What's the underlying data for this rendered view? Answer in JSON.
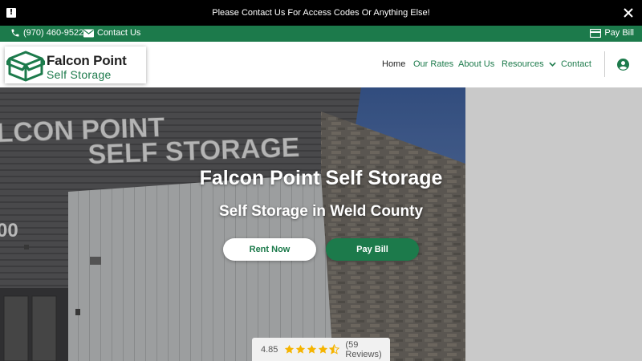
{
  "announcement": {
    "text": "Please Contact Us For Access Codes Or Anything Else!"
  },
  "topbar": {
    "phone": "(970) 460-9522",
    "contact": "Contact Us",
    "pay_bill": "Pay Bill"
  },
  "logo": {
    "line1": "Falcon Point",
    "line2": "Self Storage"
  },
  "nav": {
    "items": [
      {
        "label": "Home"
      },
      {
        "label": "Our Rates"
      },
      {
        "label": "About Us"
      },
      {
        "label": "Resources"
      },
      {
        "label": "Contact"
      }
    ]
  },
  "hero": {
    "title": "Falcon Point Self Storage",
    "subtitle": "Self Storage in Weld County",
    "rent_button": "Rent Now",
    "pay_button": "Pay Bill",
    "sign_line1": "LCON POINT",
    "sign_line2": "SELF STORAGE",
    "address_fragment": "00"
  },
  "reviews": {
    "score": "4.85",
    "count": "(59 Reviews)",
    "rating": 4.85
  },
  "colors": {
    "brand_green": "#1c7a4b",
    "announcement_bg": "#000000",
    "star": "#f5b400"
  },
  "icons": [
    "alert-icon",
    "close-icon",
    "phone-icon",
    "mail-icon",
    "credit-card-icon",
    "box-logo-icon",
    "chevron-down-icon",
    "user-circle-icon",
    "star-icon"
  ]
}
